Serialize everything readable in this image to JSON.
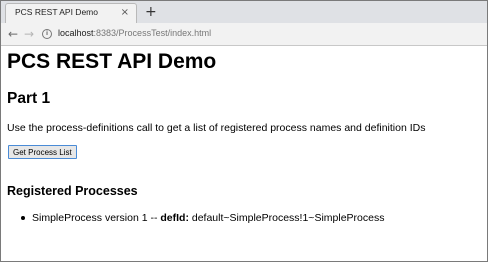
{
  "browser": {
    "tab_title": "PCS REST API Demo",
    "tab_close": "×",
    "new_tab": "+",
    "back": "←",
    "forward": "→",
    "info": "i",
    "url_host": "localhost",
    "url_rest": ":8383/ProcessTest/index.html"
  },
  "page": {
    "title": "PCS REST API Demo",
    "section_heading": "Part 1",
    "description": "Use the process-definitions call to get a list of registered process names and definition IDs",
    "button_label": "Get Process List",
    "registered_heading": "Registered Processes",
    "processes": [
      {
        "name_version": "SimpleProcess version 1 -- ",
        "defid_label": "defId:",
        "defid_value": " default~SimpleProcess!1~SimpleProcess"
      }
    ]
  }
}
